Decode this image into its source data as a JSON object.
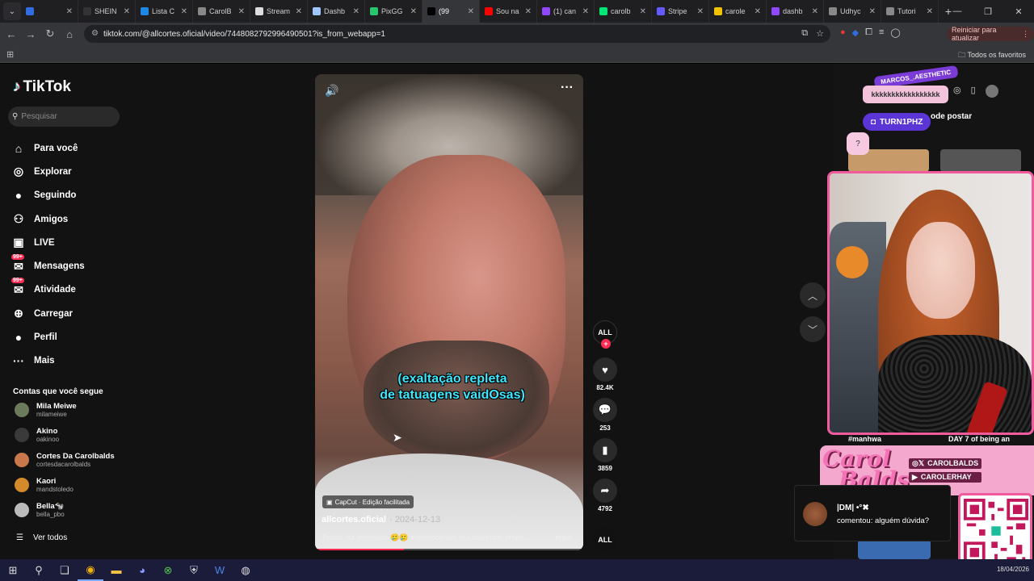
{
  "browser": {
    "tabs": [
      {
        "title": "",
        "color": "#2f6de1"
      },
      {
        "title": "SHEIN",
        "color": "#333333"
      },
      {
        "title": "Lista C",
        "color": "#1e88e5"
      },
      {
        "title": "CarolB",
        "color": "#888888"
      },
      {
        "title": "Stream",
        "color": "#dddddd"
      },
      {
        "title": "Dashb",
        "color": "#9fc7ff"
      },
      {
        "title": "PixGG",
        "color": "#28c76f"
      },
      {
        "title": "(99",
        "color": "#000000",
        "active": true
      },
      {
        "title": "Sou na",
        "color": "#ff0000"
      },
      {
        "title": "(1) can",
        "color": "#9146ff"
      },
      {
        "title": "carolb",
        "color": "#00e676"
      },
      {
        "title": "Stripe",
        "color": "#635bff"
      },
      {
        "title": "carole",
        "color": "#f2c200"
      },
      {
        "title": "dashb",
        "color": "#9146ff"
      },
      {
        "title": "Udhyc",
        "color": "#888888"
      },
      {
        "title": "Tutori",
        "color": "#888888"
      }
    ],
    "url": "tiktok.com/@allcortes.oficial/video/7448082792996490501?is_from_webapp=1",
    "restart_label": "Reiniciar para atualizar",
    "bookmarks_label": "Todos os favoritos"
  },
  "sidebar": {
    "logo": "TikTok",
    "search_placeholder": "Pesquisar",
    "nav": [
      {
        "label": "Para você",
        "icon": "home-icon"
      },
      {
        "label": "Explorar",
        "icon": "compass-icon"
      },
      {
        "label": "Seguindo",
        "icon": "following-icon"
      },
      {
        "label": "Amigos",
        "icon": "friends-icon"
      },
      {
        "label": "LIVE",
        "icon": "live-icon"
      },
      {
        "label": "Mensagens",
        "icon": "messages-icon",
        "badge": "99+"
      },
      {
        "label": "Atividade",
        "icon": "activity-icon",
        "badge": "99+"
      },
      {
        "label": "Carregar",
        "icon": "upload-icon"
      },
      {
        "label": "Perfil",
        "icon": "profile-icon"
      },
      {
        "label": "Mais",
        "icon": "more-icon"
      }
    ],
    "following_title": "Contas que você segue",
    "accounts": [
      {
        "name": "Mila Meiwe",
        "user": "milameiwe",
        "color": "#6b7a5a"
      },
      {
        "name": "Akino",
        "user": "oakinoo",
        "color": "#3a3a3a"
      },
      {
        "name": "Cortes Da Carolbalds",
        "user": "cortesdacarolbalds",
        "color": "#c8784a"
      },
      {
        "name": "Kaori",
        "user": "mandstoledo",
        "color": "#d48a2a"
      },
      {
        "name": "Bella🐄",
        "user": "bella_pbo",
        "color": "#bbbbbb"
      }
    ],
    "see_all": "Ver todos"
  },
  "video": {
    "overlay_caption_line1": "(exaltação repleta",
    "overlay_caption_line2": "de tatuagens vaidOsas)",
    "capcut_label": "CapCut · Edição facilitada",
    "author": "allcortes.oficial",
    "date": "· 2024-12-13",
    "description": "Tiozão faz delineado 🥲🥲 #renatocariani #juliobalestrin #hum...",
    "more_label": "mais",
    "progress": 0.33
  },
  "actions": {
    "avatar_text": "ALL",
    "likes": "82.4K",
    "comments": "253",
    "saves": "3859",
    "shares": "4792"
  },
  "overlay": {
    "tag_top": "MARCOS_.AESTHETIC",
    "tag_pink": "kkkkkkkkkkkkkkkkk",
    "twitch_user": "TURN1PHZ",
    "post_label": "ode postar",
    "question": "?",
    "caption_left": "#manhwa",
    "caption_right": "DAY 7 of being an",
    "carol_logo_line1": "Carol",
    "carol_logo_line2": "Balds",
    "social_1": "CAROLBALDS",
    "social_2": "CAROLERHAY",
    "notif_name": "|DM| •°✖",
    "notif_msg": "comentou: alguém dúvida?"
  },
  "taskbar": {
    "date": "18/04/2026"
  }
}
